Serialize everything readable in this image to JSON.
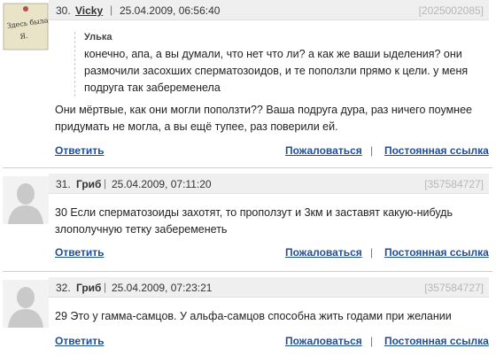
{
  "comments": [
    {
      "number": "30.",
      "author": "Vicky",
      "date": "25.04.2009, 06:56:40",
      "id": "[2025002085]",
      "avatar_note": {
        "line1": "Здесь была",
        "line2": "Я."
      },
      "quote_author": "Улька",
      "quote_text": "конечно, апа, а вы думали, что нет что ли? а как же ваши ыделения? они размочили засохших сперматозоидов, и те поползли прямо к цели. у меня подруга так забеременела",
      "text": "Они мёртвые, как они могли поползти?? Ваша подруга дура, раз ничего поумнее придумать не могла, а вы ещё тупее, раз поверили ей."
    },
    {
      "number": "31.",
      "author": "Гриб",
      "date": "25.04.2009, 07:11:20",
      "id": "[357584727]",
      "text": "30 Если сперматозоиды захотят, то проползут и 3км и заставят какую-нибудь злополучную тетку забеременеть"
    },
    {
      "number": "32.",
      "author": "Гриб",
      "date": "25.04.2009, 07:23:21",
      "id": "[357584727]",
      "text": "29 Это у гамма-самцов. У альфа-самцов способна жить годами при желании"
    }
  ],
  "actions": {
    "reply": "Ответить",
    "complain": "Пожаловаться",
    "separator": "|",
    "permalink": "Постоянная ссылка"
  },
  "header_separator": "|",
  "colors": {
    "link": "#1f4e9c",
    "header_bg": "#efefef",
    "id_text": "#b7b7b7"
  }
}
